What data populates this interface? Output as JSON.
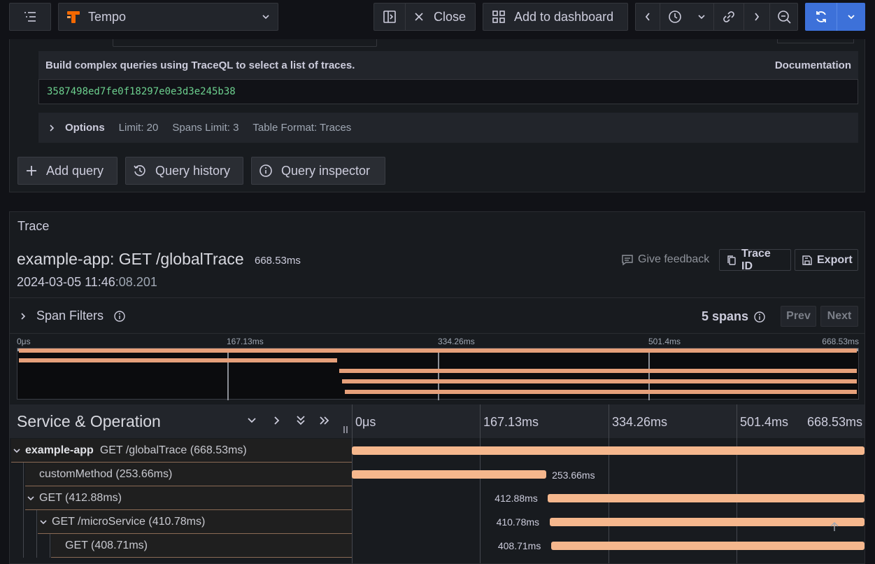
{
  "toolbar": {
    "datasource": "Tempo",
    "close_label": "Close",
    "add_dashboard_label": "Add to dashboard"
  },
  "query": {
    "hint": "Build complex queries using TraceQL to select a list of traces.",
    "documentation": "Documentation",
    "value": "3587498ed7fe0f18297e0e3d3e245b38",
    "options_label": "Options",
    "limit": "Limit: 20",
    "spans_limit": "Spans Limit: 3",
    "table_format": "Table Format: Traces",
    "add_query": "Add query",
    "query_history": "Query history",
    "query_inspector": "Query inspector"
  },
  "trace": {
    "panel_title": "Trace",
    "title": "example-app: GET /globalTrace",
    "duration": "668.53ms",
    "date_main": "2024-03-05 11:46",
    "date_sub": ":08.201",
    "give_feedback": "Give feedback",
    "trace_id_button": "Trace ID",
    "export_button": "Export",
    "span_filters": "Span Filters",
    "span_count": "5 spans",
    "prev": "Prev",
    "next": "Next"
  },
  "minimap": {
    "ticks": [
      "0μs",
      "167.13ms",
      "334.26ms",
      "501.4ms",
      "668.53ms"
    ]
  },
  "timeline": {
    "header_title": "Service & Operation",
    "ticks": [
      "0μs",
      "167.13ms",
      "334.26ms",
      "501.4ms",
      "668.53ms"
    ]
  },
  "spans": [
    {
      "service": "example-app",
      "operation": "GET /globalTrace (668.53ms)",
      "duration": "",
      "start": 0.0,
      "end": 1.0,
      "depth": 0,
      "toggle": "down"
    },
    {
      "service": "",
      "operation": "customMethod (253.66ms)",
      "duration": "253.66ms",
      "start": 0.0,
      "end": 0.3794,
      "depth": 1,
      "toggle": ""
    },
    {
      "service": "",
      "operation": "GET (412.88ms)",
      "duration": "412.88ms",
      "start": 0.3824,
      "end": 1.0,
      "depth": 1,
      "toggle": "down"
    },
    {
      "service": "",
      "operation": "GET /microService (410.78ms)",
      "duration": "410.78ms",
      "start": 0.3855,
      "end": 1.0,
      "depth": 2,
      "toggle": "down"
    },
    {
      "service": "",
      "operation": "GET (408.71ms)",
      "duration": "408.71ms",
      "start": 0.3886,
      "end": 1.0,
      "depth": 3,
      "toggle": ""
    }
  ],
  "colors": {
    "span_bar": "#f5b78d",
    "minimap_bar": "#e6a07a",
    "accent": "#3d71d9",
    "query_text": "#6ccf8e"
  }
}
